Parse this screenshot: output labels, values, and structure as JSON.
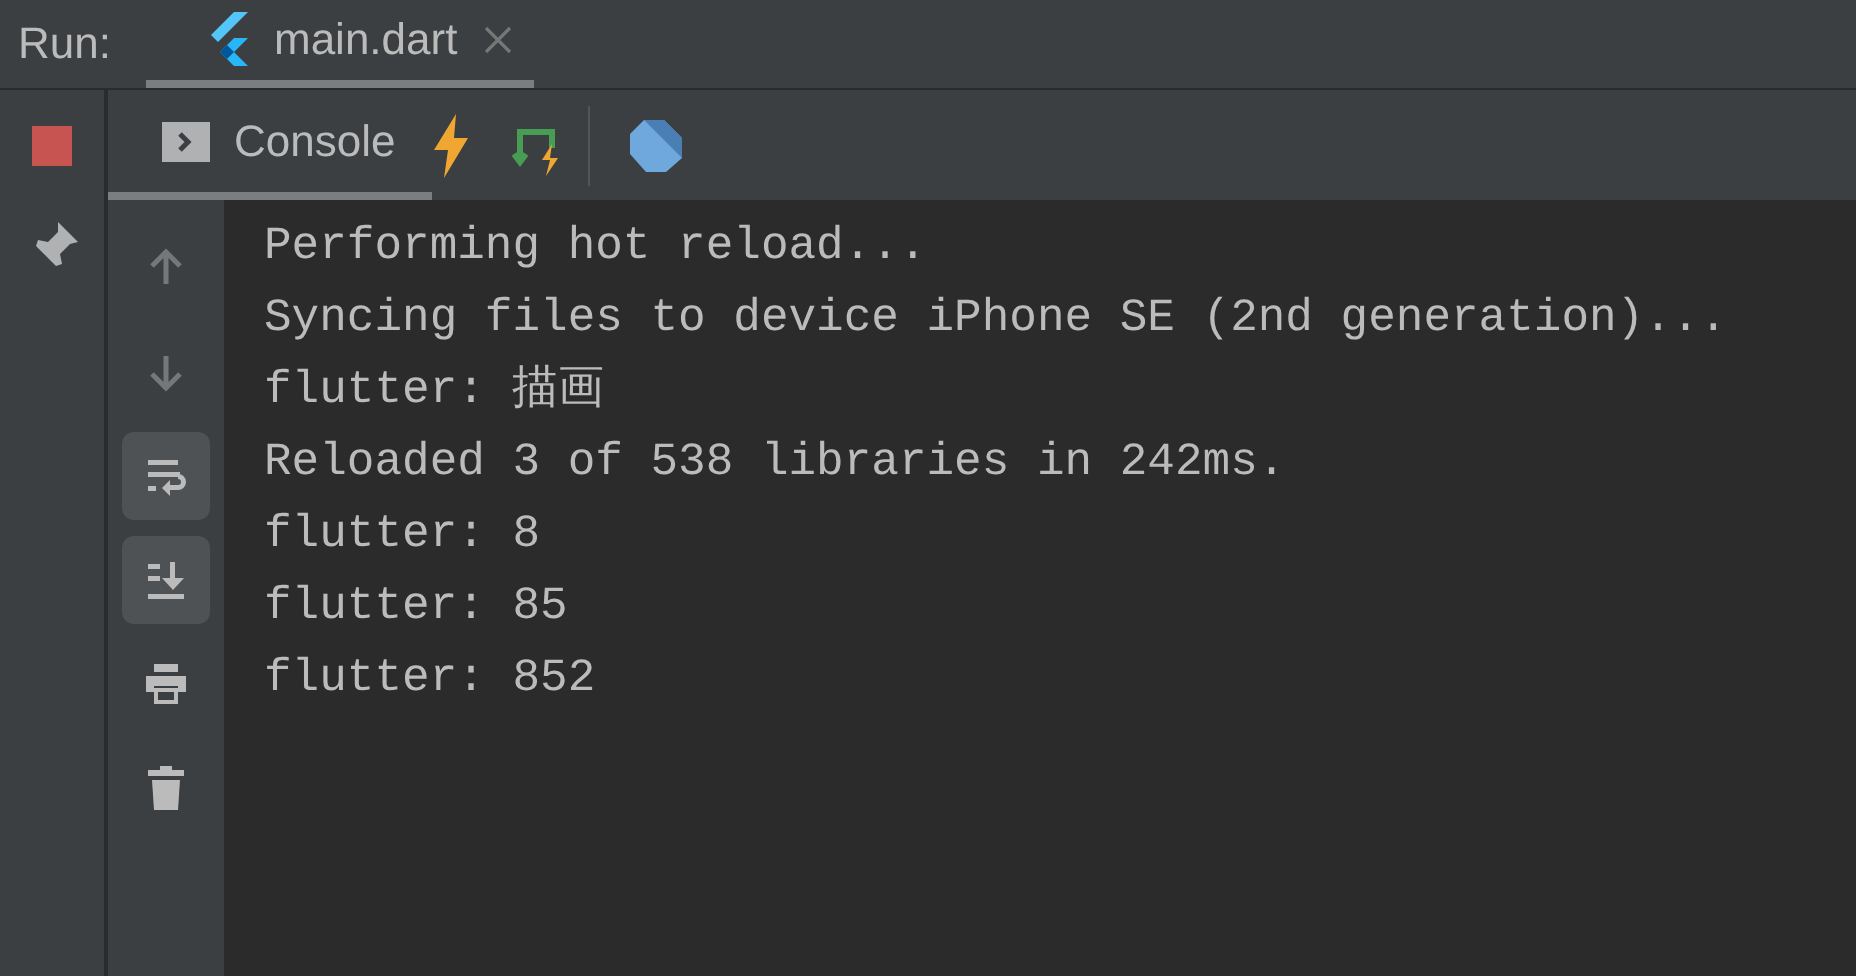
{
  "run_bar": {
    "label": "Run:",
    "tabs": [
      {
        "label": "main.dart",
        "selected": true
      }
    ]
  },
  "toolbar": {
    "tabs": [
      {
        "label": "Console",
        "selected": true
      }
    ]
  },
  "side_tools": [
    {
      "kind": "up",
      "disabled": true
    },
    {
      "kind": "down",
      "disabled": true
    },
    {
      "kind": "wrap",
      "on": true
    },
    {
      "kind": "scroll",
      "on": true
    },
    {
      "kind": "print",
      "on": false
    },
    {
      "kind": "trash",
      "on": false
    }
  ],
  "console": {
    "lines": [
      "Performing hot reload...",
      "Syncing files to device iPhone SE (2nd generation)...",
      "flutter: 描画",
      "Reloaded 3 of 538 libraries in 242ms.",
      "flutter: 8",
      "flutter: 85",
      "flutter: 852"
    ]
  }
}
